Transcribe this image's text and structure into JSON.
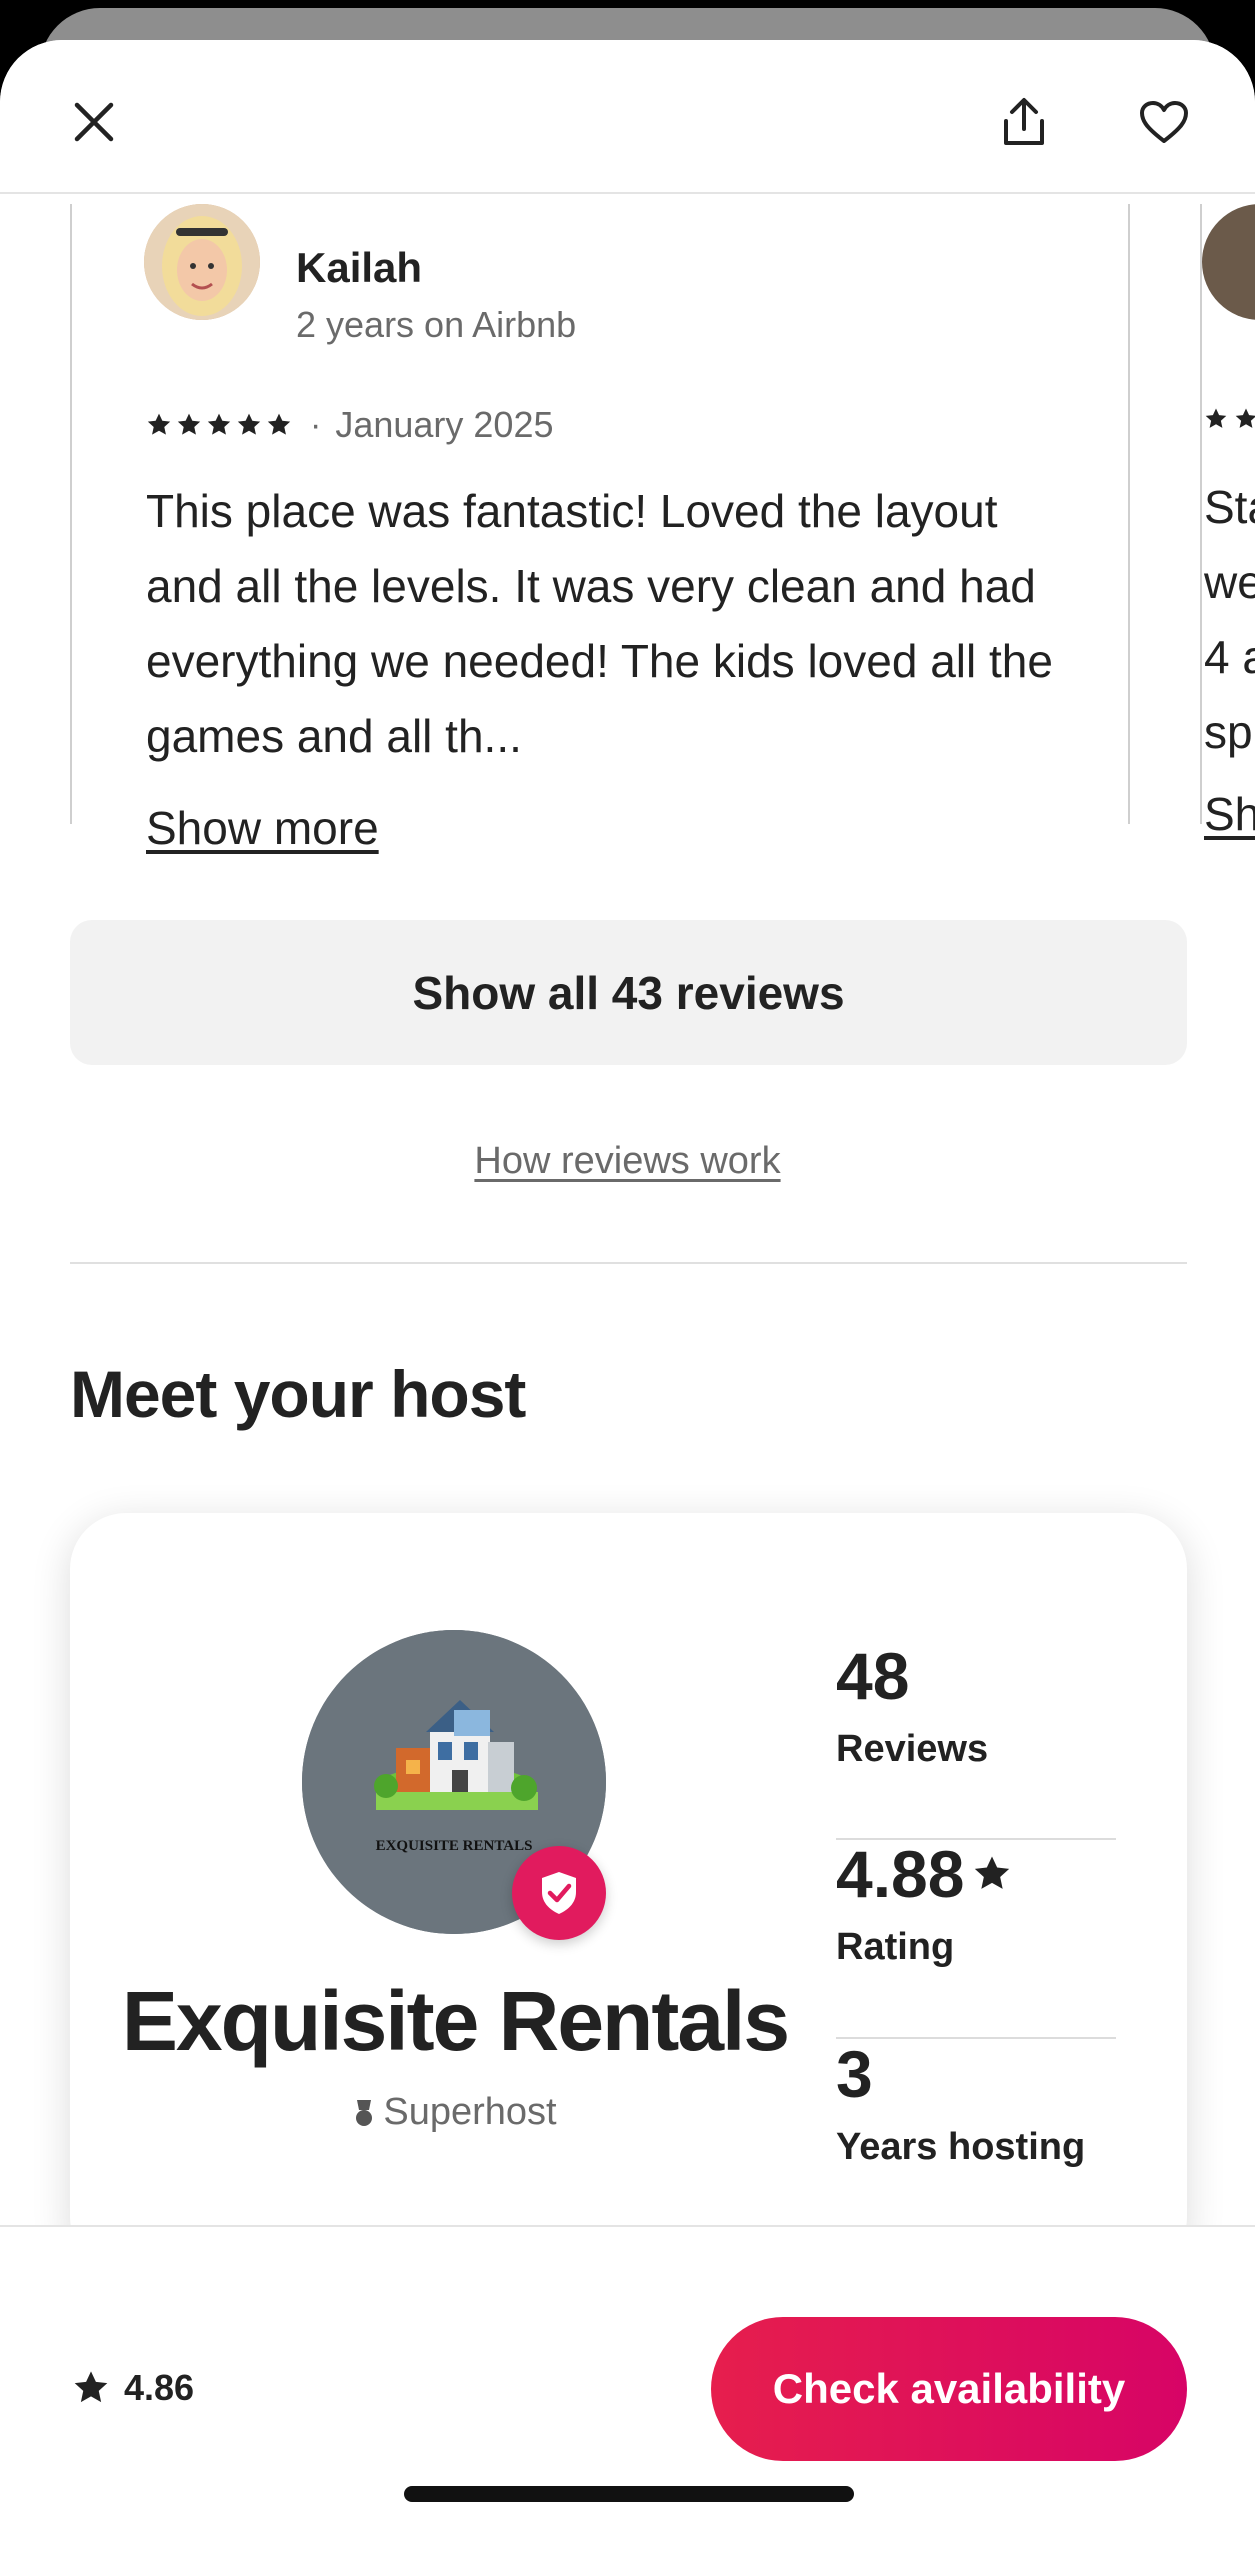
{
  "topbar": {
    "close_icon": "close-icon",
    "share_icon": "share-icon",
    "save_icon": "heart-icon"
  },
  "review": {
    "name": "Kailah",
    "meta": "2 years on Airbnb",
    "stars": 5,
    "separator": "·",
    "date": "January 2025",
    "text": "This place was fantastic! Loved the layout and all the levels. It was very clean and had everything we needed! The kids loved all the games and all th...",
    "show_more": "Show more"
  },
  "peek_review": {
    "lines": [
      "Sta",
      "we",
      "4 a",
      "sp"
    ],
    "show_more": "Sh"
  },
  "reviews_button": "Show all 43 reviews",
  "how_reviews": "How reviews work",
  "section_title": "Meet your host",
  "host": {
    "logo_text": "EXQUISITE RENTALS",
    "name": "Exquisite Rentals",
    "badge": "Superhost",
    "stats": [
      {
        "value": "48",
        "label": "Reviews"
      },
      {
        "value": "4.88",
        "label": "Rating"
      },
      {
        "value": "3",
        "label": "Years hosting"
      }
    ]
  },
  "bottom": {
    "rating": "4.86",
    "cta": "Check availability"
  },
  "colors": {
    "brand": "#e61e4d",
    "badge": "#e11b5e",
    "muted": "#6a6a6a"
  }
}
